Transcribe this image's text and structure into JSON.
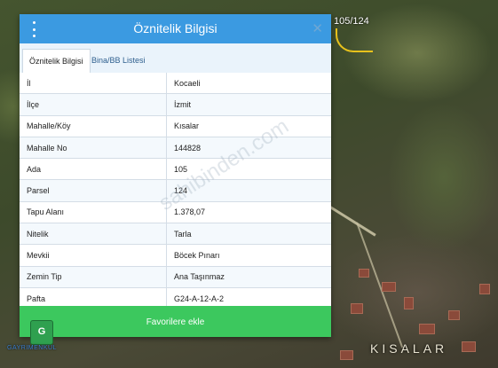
{
  "map": {
    "parcel_label": "105/124",
    "village_label": "KISALAR"
  },
  "dialog": {
    "title": "Öznitelik Bilgisi",
    "close_glyph": "✕",
    "tabs": [
      {
        "label": "Öznitelik Bilgisi",
        "active": true
      },
      {
        "label": "Bina/BB Listesi",
        "active": false
      }
    ],
    "rows": [
      {
        "key": "İl",
        "value": "Kocaeli"
      },
      {
        "key": "İlçe",
        "value": "İzmit"
      },
      {
        "key": "Mahalle/Köy",
        "value": "Kısalar"
      },
      {
        "key": "Mahalle No",
        "value": "144828"
      },
      {
        "key": "Ada",
        "value": "105"
      },
      {
        "key": "Parsel",
        "value": "124"
      },
      {
        "key": "Tapu Alanı",
        "value": "1.378,07"
      },
      {
        "key": "Nitelik",
        "value": "Tarla"
      },
      {
        "key": "Mevkii",
        "value": "Böcek Pınarı"
      },
      {
        "key": "Zemin Tip",
        "value": "Ana Taşınmaz"
      },
      {
        "key": "Pafta",
        "value": "G24-A-12-A-2"
      }
    ],
    "favorite_button": "Favorilere ekle"
  },
  "watermark": "sahibinden.com",
  "logo": {
    "badge": "G",
    "text": "GAYRIMENKUL"
  },
  "colors": {
    "header": "#3b9ae1",
    "button": "#3cc85e",
    "parcel_line": "#e8c21c"
  }
}
